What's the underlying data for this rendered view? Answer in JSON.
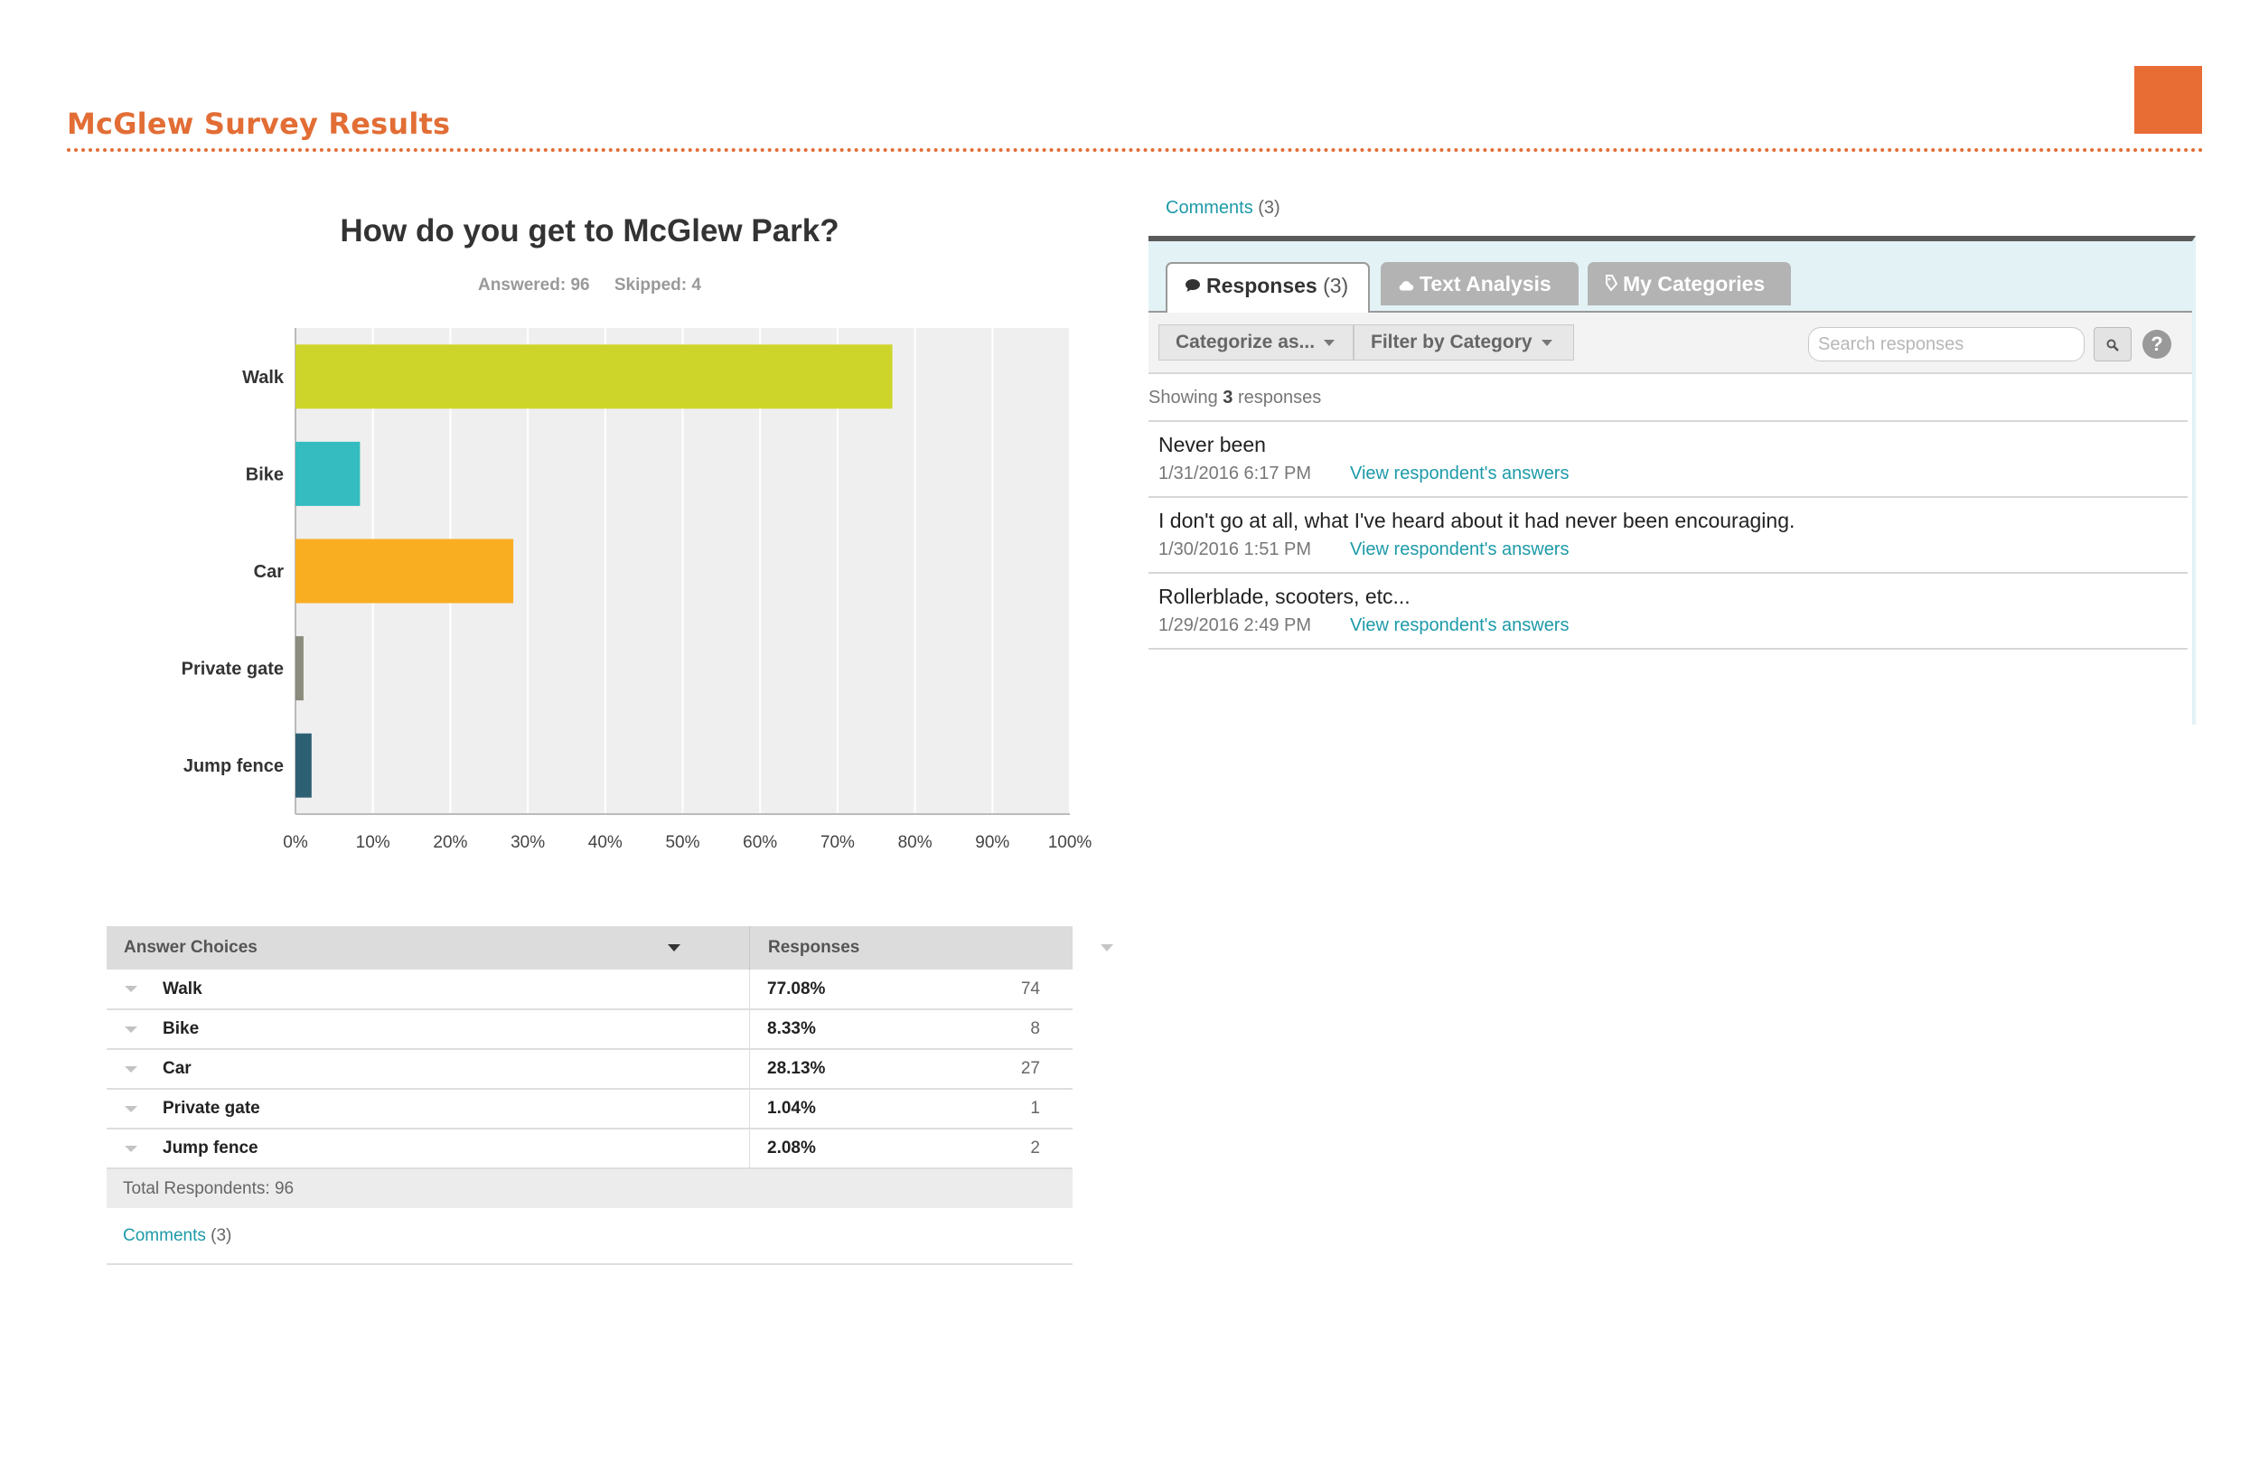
{
  "page": {
    "title": "McGlew Survey Results",
    "accent_color": "#e26d35"
  },
  "question": {
    "title": "How do you get to McGlew Park?",
    "answered_label": "Answered: 96",
    "skipped_label": "Skipped: 4"
  },
  "chart_data": {
    "type": "bar",
    "orientation": "horizontal",
    "categories": [
      "Walk",
      "Bike",
      "Car",
      "Private gate",
      "Jump fence"
    ],
    "values": [
      77.08,
      8.33,
      28.13,
      1.04,
      2.08
    ],
    "colors": [
      "#ced52a",
      "#35bcc0",
      "#f9ae22",
      "#8b8b7e",
      "#2e6074"
    ],
    "xlim": [
      0,
      100
    ],
    "x_ticks": [
      "0%",
      "10%",
      "20%",
      "30%",
      "40%",
      "50%",
      "60%",
      "70%",
      "80%",
      "90%",
      "100%"
    ],
    "grid": true,
    "legend": "none"
  },
  "answer_table": {
    "headers": {
      "choices": "Answer Choices",
      "responses": "Responses"
    },
    "rows": [
      {
        "label": "Walk",
        "percent": "77.08%",
        "count": "74"
      },
      {
        "label": "Bike",
        "percent": "8.33%",
        "count": "8"
      },
      {
        "label": "Car",
        "percent": "28.13%",
        "count": "27"
      },
      {
        "label": "Private gate",
        "percent": "1.04%",
        "count": "1"
      },
      {
        "label": "Jump fence",
        "percent": "2.08%",
        "count": "2"
      }
    ],
    "total_label": "Total Respondents: 96",
    "comments_link": "Comments",
    "comments_count": "(3)"
  },
  "comments_panel": {
    "top_link": "Comments",
    "top_count": "(3)",
    "tabs": [
      {
        "label": "Responses",
        "count": "(3)",
        "icon": "speech-bubble-icon"
      },
      {
        "label": "Text Analysis",
        "icon": "cloud-icon"
      },
      {
        "label": "My Categories",
        "icon": "tag-icon"
      }
    ],
    "toolbar": {
      "categorize": "Categorize as...",
      "filter": "Filter by Category",
      "search_placeholder": "Search responses",
      "help": "?"
    },
    "showing_prefix": "Showing",
    "showing_count": "3",
    "showing_suffix": "responses",
    "responses": [
      {
        "text": "Never been",
        "date": "1/31/2016 6:17 PM",
        "link": "View respondent's answers"
      },
      {
        "text": "I don't go at all, what I've heard about it had never been encouraging.",
        "date": "1/30/2016 1:51 PM",
        "link": "View respondent's answers"
      },
      {
        "text": "Rollerblade, scooters, etc...",
        "date": "1/29/2016 2:49 PM",
        "link": "View respondent's answers"
      }
    ]
  }
}
